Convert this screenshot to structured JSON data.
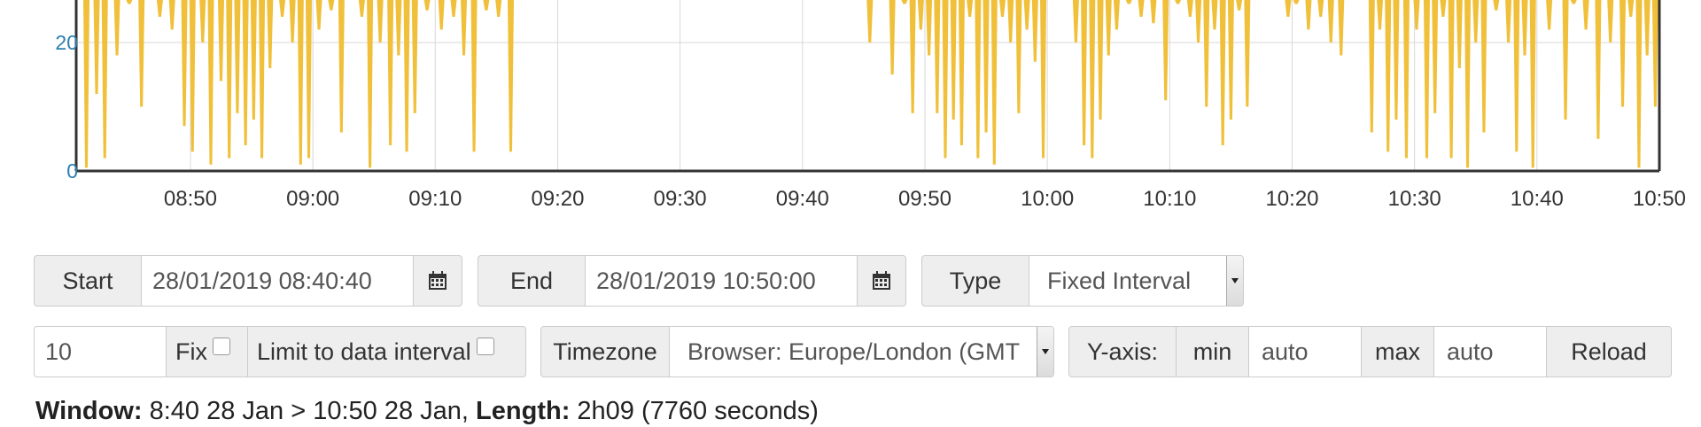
{
  "chart_data": {
    "type": "bar",
    "x_tick_labels": [
      "08:50",
      "09:00",
      "09:10",
      "09:20",
      "09:30",
      "09:40",
      "09:50",
      "10:00",
      "10:10",
      "10:20",
      "10:30",
      "10:40",
      "10:50"
    ],
    "y_tick_labels": [
      "0",
      "20"
    ],
    "x_range": [
      "08:40:40",
      "10:50:00"
    ],
    "y_range_visible": [
      0,
      27
    ],
    "series": [
      {
        "color": "#f0c03a",
        "note": "dense spikes; top clipped",
        "bars": [
          {
            "t": "08:41:30",
            "bottom": 0.5
          },
          {
            "t": "08:42:20",
            "bottom": 12
          },
          {
            "t": "08:43:00",
            "bottom": 2
          },
          {
            "t": "08:44:00",
            "bottom": 18
          },
          {
            "t": "08:45:00",
            "bottom": 26
          },
          {
            "t": "08:46:00",
            "bottom": 10
          },
          {
            "t": "08:47:30",
            "bottom": 24
          },
          {
            "t": "08:48:30",
            "bottom": 22
          },
          {
            "t": "08:49:30",
            "bottom": 7
          },
          {
            "t": "08:50:10",
            "bottom": 3
          },
          {
            "t": "08:51:00",
            "bottom": 20
          },
          {
            "t": "08:51:40",
            "bottom": 1
          },
          {
            "t": "08:52:30",
            "bottom": 14
          },
          {
            "t": "08:53:10",
            "bottom": 2
          },
          {
            "t": "08:53:50",
            "bottom": 9
          },
          {
            "t": "08:54:30",
            "bottom": 4
          },
          {
            "t": "08:55:10",
            "bottom": 8
          },
          {
            "t": "08:55:50",
            "bottom": 2
          },
          {
            "t": "08:56:30",
            "bottom": 16
          },
          {
            "t": "08:57:30",
            "bottom": 24
          },
          {
            "t": "08:58:20",
            "bottom": 20
          },
          {
            "t": "08:59:00",
            "bottom": 1
          },
          {
            "t": "08:59:40",
            "bottom": 2
          },
          {
            "t": "09:00:30",
            "bottom": 22
          },
          {
            "t": "09:01:30",
            "bottom": 25
          },
          {
            "t": "09:02:20",
            "bottom": 6
          },
          {
            "t": "09:03:00",
            "bottom": 27
          },
          {
            "t": "09:04:00",
            "bottom": 24
          },
          {
            "t": "09:04:40",
            "bottom": 0.5
          },
          {
            "t": "09:05:30",
            "bottom": 20
          },
          {
            "t": "09:06:20",
            "bottom": 4
          },
          {
            "t": "09:07:00",
            "bottom": 18
          },
          {
            "t": "09:07:40",
            "bottom": 3
          },
          {
            "t": "09:08:20",
            "bottom": 9
          },
          {
            "t": "09:09:20",
            "bottom": 25
          },
          {
            "t": "09:10:30",
            "bottom": 22
          },
          {
            "t": "09:11:30",
            "bottom": 24
          },
          {
            "t": "09:12:20",
            "bottom": 18
          },
          {
            "t": "09:13:10",
            "bottom": 3
          },
          {
            "t": "09:14:10",
            "bottom": 25
          },
          {
            "t": "09:15:10",
            "bottom": 24
          },
          {
            "t": "09:16:10",
            "bottom": 3
          },
          {
            "t": "09:45:30",
            "bottom": 20
          },
          {
            "t": "09:47:20",
            "bottom": 15
          },
          {
            "t": "09:48:20",
            "bottom": 26
          },
          {
            "t": "09:49:00",
            "bottom": 9
          },
          {
            "t": "09:49:40",
            "bottom": 22
          },
          {
            "t": "09:50:20",
            "bottom": 18
          },
          {
            "t": "09:51:00",
            "bottom": 9
          },
          {
            "t": "09:51:40",
            "bottom": 2
          },
          {
            "t": "09:52:20",
            "bottom": 8
          },
          {
            "t": "09:53:00",
            "bottom": 4
          },
          {
            "t": "09:53:40",
            "bottom": 24
          },
          {
            "t": "09:54:20",
            "bottom": 2
          },
          {
            "t": "09:55:00",
            "bottom": 6
          },
          {
            "t": "09:55:40",
            "bottom": 1
          },
          {
            "t": "09:56:20",
            "bottom": 24
          },
          {
            "t": "09:57:00",
            "bottom": 20
          },
          {
            "t": "09:57:40",
            "bottom": 9
          },
          {
            "t": "09:58:20",
            "bottom": 22
          },
          {
            "t": "09:59:00",
            "bottom": 17
          },
          {
            "t": "09:59:40",
            "bottom": 2
          },
          {
            "t": "10:02:20",
            "bottom": 20
          },
          {
            "t": "10:03:00",
            "bottom": 4
          },
          {
            "t": "10:03:40",
            "bottom": 2
          },
          {
            "t": "10:04:20",
            "bottom": 8
          },
          {
            "t": "10:05:00",
            "bottom": 18
          },
          {
            "t": "10:05:40",
            "bottom": 22
          },
          {
            "t": "10:06:40",
            "bottom": 26
          },
          {
            "t": "10:07:40",
            "bottom": 24
          },
          {
            "t": "10:08:40",
            "bottom": 23
          },
          {
            "t": "10:09:40",
            "bottom": 11
          },
          {
            "t": "10:10:40",
            "bottom": 26
          },
          {
            "t": "10:11:40",
            "bottom": 24
          },
          {
            "t": "10:12:20",
            "bottom": 20
          },
          {
            "t": "10:13:00",
            "bottom": 10
          },
          {
            "t": "10:13:40",
            "bottom": 22
          },
          {
            "t": "10:14:20",
            "bottom": 4
          },
          {
            "t": "10:15:00",
            "bottom": 8
          },
          {
            "t": "10:15:40",
            "bottom": 25
          },
          {
            "t": "10:16:20",
            "bottom": 10
          },
          {
            "t": "10:19:40",
            "bottom": 24
          },
          {
            "t": "10:20:20",
            "bottom": 26
          },
          {
            "t": "10:21:20",
            "bottom": 22
          },
          {
            "t": "10:22:20",
            "bottom": 24
          },
          {
            "t": "10:23:10",
            "bottom": 20
          },
          {
            "t": "10:24:00",
            "bottom": 18
          },
          {
            "t": "10:26:30",
            "bottom": 6
          },
          {
            "t": "10:27:10",
            "bottom": 22
          },
          {
            "t": "10:27:50",
            "bottom": 3
          },
          {
            "t": "10:28:30",
            "bottom": 8
          },
          {
            "t": "10:29:20",
            "bottom": 2
          },
          {
            "t": "10:30:10",
            "bottom": 22
          },
          {
            "t": "10:31:00",
            "bottom": 2
          },
          {
            "t": "10:31:40",
            "bottom": 9
          },
          {
            "t": "10:32:20",
            "bottom": 24
          },
          {
            "t": "10:33:00",
            "bottom": 2
          },
          {
            "t": "10:33:40",
            "bottom": 16
          },
          {
            "t": "10:34:20",
            "bottom": 0.5
          },
          {
            "t": "10:35:00",
            "bottom": 20
          },
          {
            "t": "10:35:40",
            "bottom": 6
          },
          {
            "t": "10:36:40",
            "bottom": 25
          },
          {
            "t": "10:37:40",
            "bottom": 20
          },
          {
            "t": "10:38:20",
            "bottom": 3
          },
          {
            "t": "10:39:00",
            "bottom": 18
          },
          {
            "t": "10:39:40",
            "bottom": 0.5
          },
          {
            "t": "10:41:00",
            "bottom": 22
          },
          {
            "t": "10:42:20",
            "bottom": 8
          },
          {
            "t": "10:43:00",
            "bottom": 26
          },
          {
            "t": "10:44:00",
            "bottom": 22
          },
          {
            "t": "10:45:00",
            "bottom": 5
          },
          {
            "t": "10:46:00",
            "bottom": 20
          },
          {
            "t": "10:47:00",
            "bottom": 10
          },
          {
            "t": "10:47:40",
            "bottom": 24
          },
          {
            "t": "10:48:20",
            "bottom": 0.5
          },
          {
            "t": "10:49:00",
            "bottom": 18
          },
          {
            "t": "10:49:40",
            "bottom": 10
          }
        ]
      }
    ]
  },
  "controls": {
    "start_label": "Start",
    "start_value": "28/01/2019 08:40:40",
    "end_label": "End",
    "end_value": "28/01/2019 10:50:00",
    "type_label": "Type",
    "type_value": "Fixed Interval",
    "interval_value": "10",
    "fix_label": "Fix",
    "limit_label": "Limit to data interval",
    "timezone_label": "Timezone",
    "timezone_value": "Browser: Europe/London (GMT",
    "yaxis_label": "Y-axis:",
    "min_label": "min",
    "min_value": "auto",
    "max_label": "max",
    "max_value": "auto",
    "reload_label": "Reload"
  },
  "summary": {
    "window_label": "Window:",
    "window_value": "8:40 28 Jan > 10:50 28 Jan,",
    "length_label": "Length:",
    "length_value": "2h09 (7760 seconds)"
  }
}
